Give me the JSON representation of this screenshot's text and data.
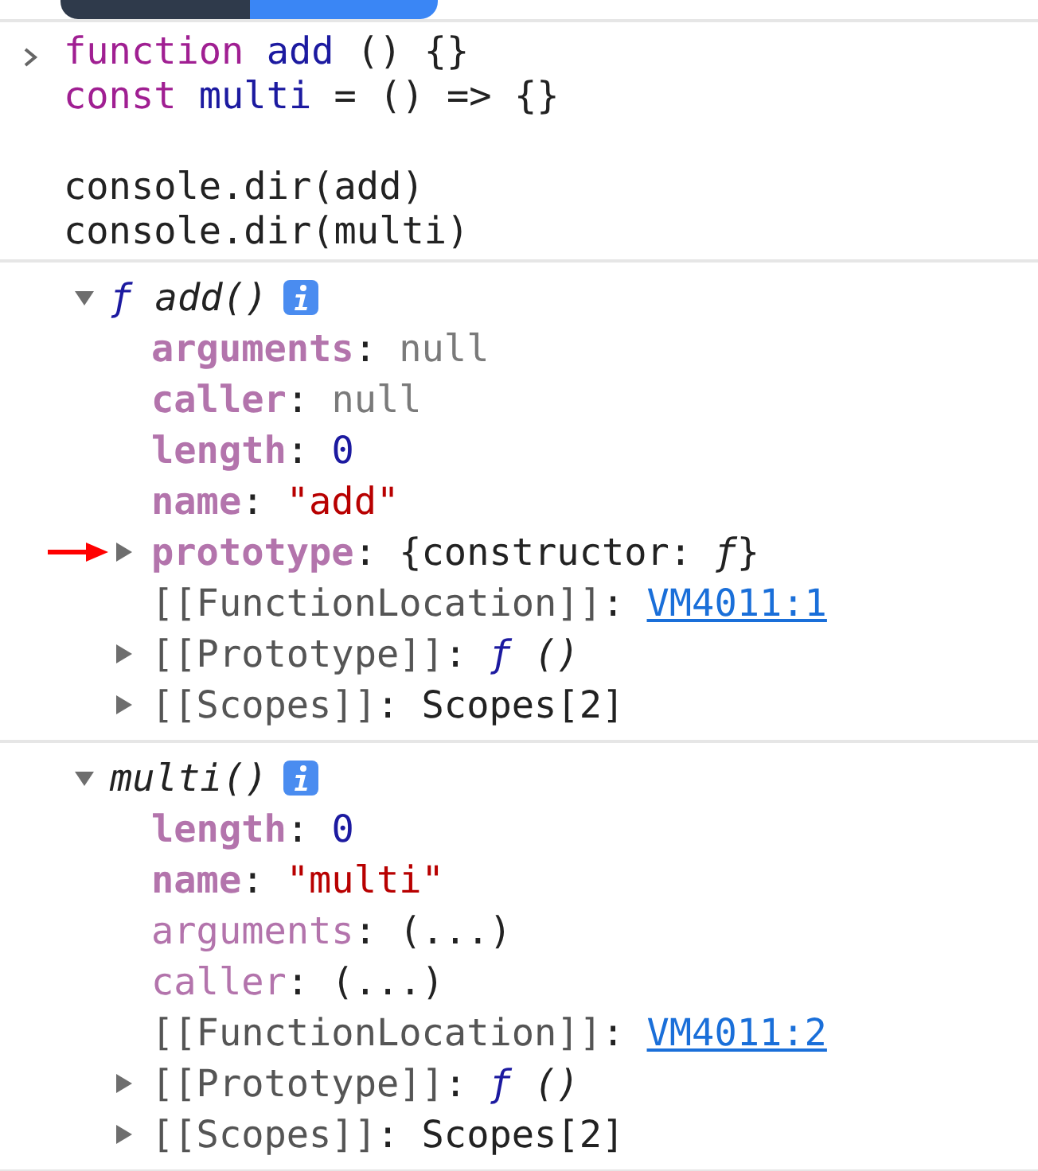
{
  "input": {
    "blocks": [
      [
        [
          {
            "kind": "keyword",
            "text": "function "
          },
          {
            "kind": "def",
            "text": "add"
          },
          {
            "kind": "plain",
            "text": " () {}"
          }
        ],
        [
          {
            "kind": "keyword",
            "text": "const "
          },
          {
            "kind": "def",
            "text": "multi"
          },
          {
            "kind": "plain",
            "text": " = () => {}"
          }
        ]
      ],
      [
        [
          {
            "kind": "plain",
            "text": "console.dir(add)"
          }
        ],
        [
          {
            "kind": "plain",
            "text": "console.dir(multi)"
          }
        ]
      ]
    ]
  },
  "outputs": [
    {
      "expanded": true,
      "title": [
        {
          "kind": "fn",
          "text": "ƒ"
        },
        {
          "kind": "italic",
          "text": " add()"
        }
      ],
      "properties": [
        {
          "key": "arguments",
          "kind": "own",
          "value": [
            {
              "kind": "plain",
              "text": ": "
            },
            {
              "kind": "null",
              "text": "null"
            }
          ],
          "has_toggle": false,
          "pointer": false
        },
        {
          "key": "caller",
          "kind": "own",
          "value": [
            {
              "kind": "plain",
              "text": ": "
            },
            {
              "kind": "null",
              "text": "null"
            }
          ],
          "has_toggle": false,
          "pointer": false
        },
        {
          "key": "length",
          "kind": "own",
          "value": [
            {
              "kind": "plain",
              "text": ": "
            },
            {
              "kind": "number",
              "text": "0"
            }
          ],
          "has_toggle": false,
          "pointer": false
        },
        {
          "key": "name",
          "kind": "own",
          "value": [
            {
              "kind": "plain",
              "text": ": "
            },
            {
              "kind": "string",
              "text": "\"add\""
            }
          ],
          "has_toggle": false,
          "pointer": false
        },
        {
          "key": "prototype",
          "kind": "own",
          "value": [
            {
              "kind": "plain",
              "text": ": {constructor: "
            },
            {
              "kind": "italic",
              "text": "ƒ"
            },
            {
              "kind": "plain",
              "text": "}"
            }
          ],
          "has_toggle": true,
          "pointer": true
        },
        {
          "key": "[[FunctionLocation]]",
          "kind": "internal",
          "value": [
            {
              "kind": "plain",
              "text": ": "
            },
            {
              "kind": "link",
              "text": "VM4011:1"
            }
          ],
          "has_toggle": false,
          "pointer": false
        },
        {
          "key": "[[Prototype]]",
          "kind": "internal",
          "value": [
            {
              "kind": "plain",
              "text": ": "
            },
            {
              "kind": "fn",
              "text": "ƒ"
            },
            {
              "kind": "italic",
              "text": " ()"
            }
          ],
          "has_toggle": true,
          "pointer": false
        },
        {
          "key": "[[Scopes]]",
          "kind": "internal",
          "value": [
            {
              "kind": "plain",
              "text": ": Scopes[2]"
            }
          ],
          "has_toggle": true,
          "pointer": false
        }
      ]
    },
    {
      "expanded": true,
      "title": [
        {
          "kind": "italic",
          "text": "multi()"
        }
      ],
      "properties": [
        {
          "key": "length",
          "kind": "own",
          "value": [
            {
              "kind": "plain",
              "text": ": "
            },
            {
              "kind": "number",
              "text": "0"
            }
          ],
          "has_toggle": false,
          "pointer": false
        },
        {
          "key": "name",
          "kind": "own",
          "value": [
            {
              "kind": "plain",
              "text": ": "
            },
            {
              "kind": "string",
              "text": "\"multi\""
            }
          ],
          "has_toggle": false,
          "pointer": false
        },
        {
          "key": "arguments",
          "kind": "lazy",
          "value": [
            {
              "kind": "plain",
              "text": ": (...)"
            }
          ],
          "has_toggle": false,
          "pointer": false
        },
        {
          "key": "caller",
          "kind": "lazy",
          "value": [
            {
              "kind": "plain",
              "text": ": (...)"
            }
          ],
          "has_toggle": false,
          "pointer": false
        },
        {
          "key": "[[FunctionLocation]]",
          "kind": "internal",
          "value": [
            {
              "kind": "plain",
              "text": ": "
            },
            {
              "kind": "link",
              "text": "VM4011:2"
            }
          ],
          "has_toggle": false,
          "pointer": false
        },
        {
          "key": "[[Prototype]]",
          "kind": "internal",
          "value": [
            {
              "kind": "plain",
              "text": ": "
            },
            {
              "kind": "fn",
              "text": "ƒ"
            },
            {
              "kind": "italic",
              "text": " ()"
            }
          ],
          "has_toggle": true,
          "pointer": false
        },
        {
          "key": "[[Scopes]]",
          "kind": "internal",
          "value": [
            {
              "kind": "plain",
              "text": ": Scopes[2]"
            }
          ],
          "has_toggle": true,
          "pointer": false
        }
      ]
    }
  ]
}
